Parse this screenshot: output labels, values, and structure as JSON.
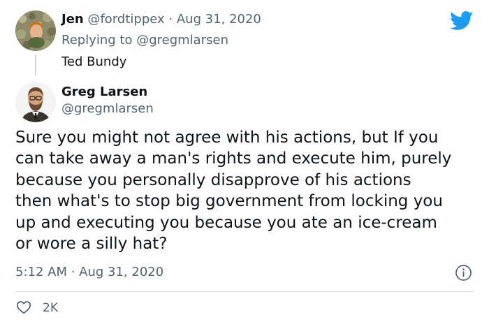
{
  "reply": {
    "name": "Jen",
    "handle": "@fordtippex",
    "separator": "·",
    "date": "Aug 31, 2020",
    "replying_prefix": "Replying to",
    "replying_to": "@gregmlarsen",
    "text": "Ted Bundy"
  },
  "tweet": {
    "name": "Greg Larsen",
    "handle": "@gregmlarsen",
    "text_lines": [
      "Sure you might not agree with his actions, but If you",
      "can take away a man's rights and execute him, purely",
      "because you personally disapprove of his actions",
      "then what's to stop big government from locking you",
      "up and executing you because you ate an ice-cream",
      "or wore a silly hat?"
    ],
    "timestamp": "5:12 AM · Aug 31, 2020",
    "likes": "2K"
  },
  "icons": {
    "brand": "twitter-bird-icon",
    "info": "info-icon",
    "like": "heart-icon"
  },
  "colors": {
    "brand": "#1d9bf0",
    "text": "#0f1419",
    "secondary": "#536471",
    "border": "#cfd9de"
  }
}
